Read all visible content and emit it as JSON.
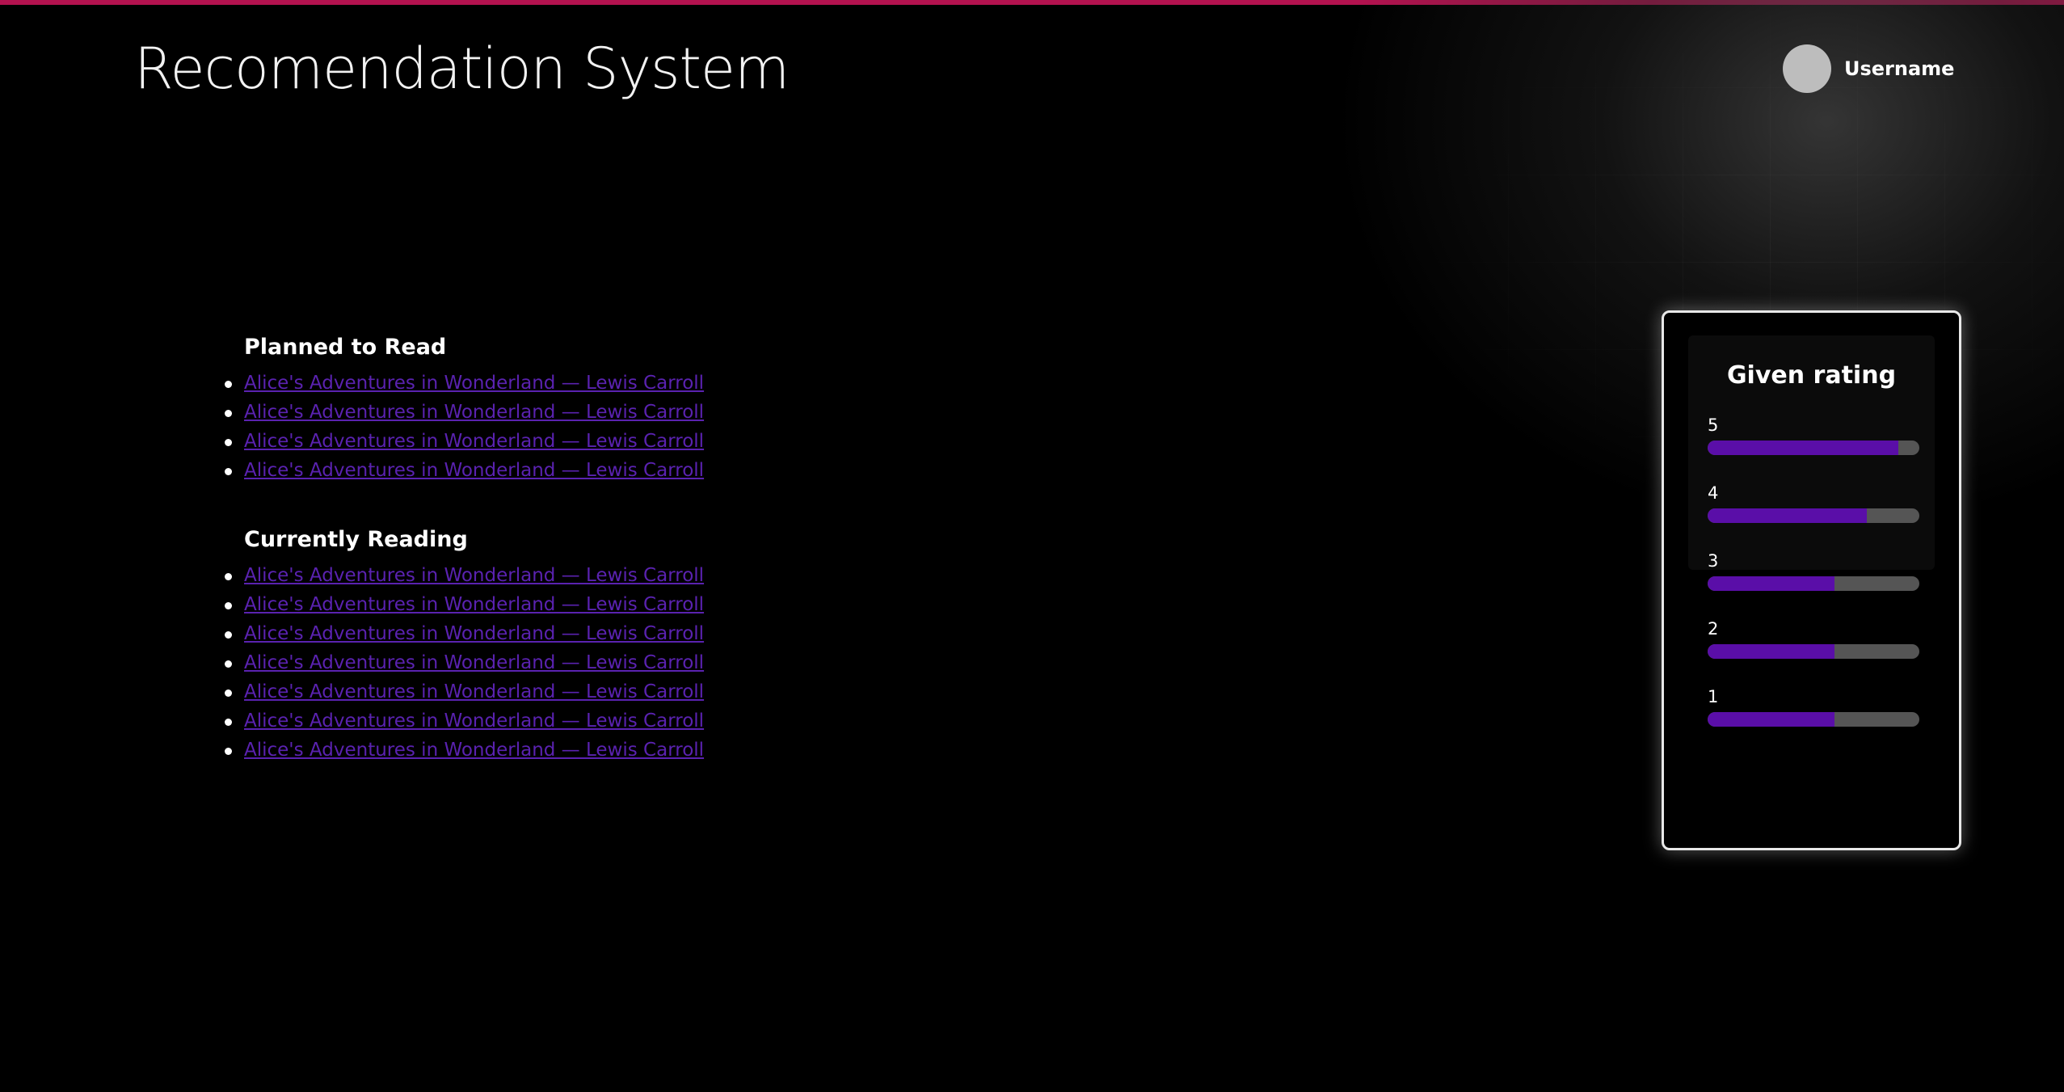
{
  "app": {
    "title": "Recomendation System"
  },
  "user": {
    "name": "Username"
  },
  "planned": {
    "title": "Planned to Read",
    "items": [
      "Alice's Adventures in Wonderland — Lewis Carroll",
      "Alice's Adventures in Wonderland — Lewis Carroll",
      "Alice's Adventures in Wonderland — Lewis Carroll",
      "Alice's Adventures in Wonderland — Lewis Carroll"
    ]
  },
  "reading": {
    "title": "Currently Reading",
    "items": [
      "Alice's Adventures in Wonderland — Lewis Carroll",
      "Alice's Adventures in Wonderland — Lewis Carroll",
      "Alice's Adventures in Wonderland — Lewis Carroll",
      "Alice's Adventures in Wonderland — Lewis Carroll",
      "Alice's Adventures in Wonderland — Lewis Carroll",
      "Alice's Adventures in Wonderland — Lewis Carroll",
      "Alice's Adventures in Wonderland — Lewis Carroll"
    ]
  },
  "rating": {
    "title": "Given rating",
    "bars": [
      {
        "label": "5",
        "fraction": 0.9
      },
      {
        "label": "4",
        "fraction": 0.75
      },
      {
        "label": "3",
        "fraction": 0.6
      },
      {
        "label": "2",
        "fraction": 0.6
      },
      {
        "label": "1",
        "fraction": 0.6
      }
    ]
  },
  "colors": {
    "accent": "#b3124f",
    "link": "#5a22b0",
    "bar_fill": "#5a0ea8",
    "bar_track": "#555555"
  }
}
